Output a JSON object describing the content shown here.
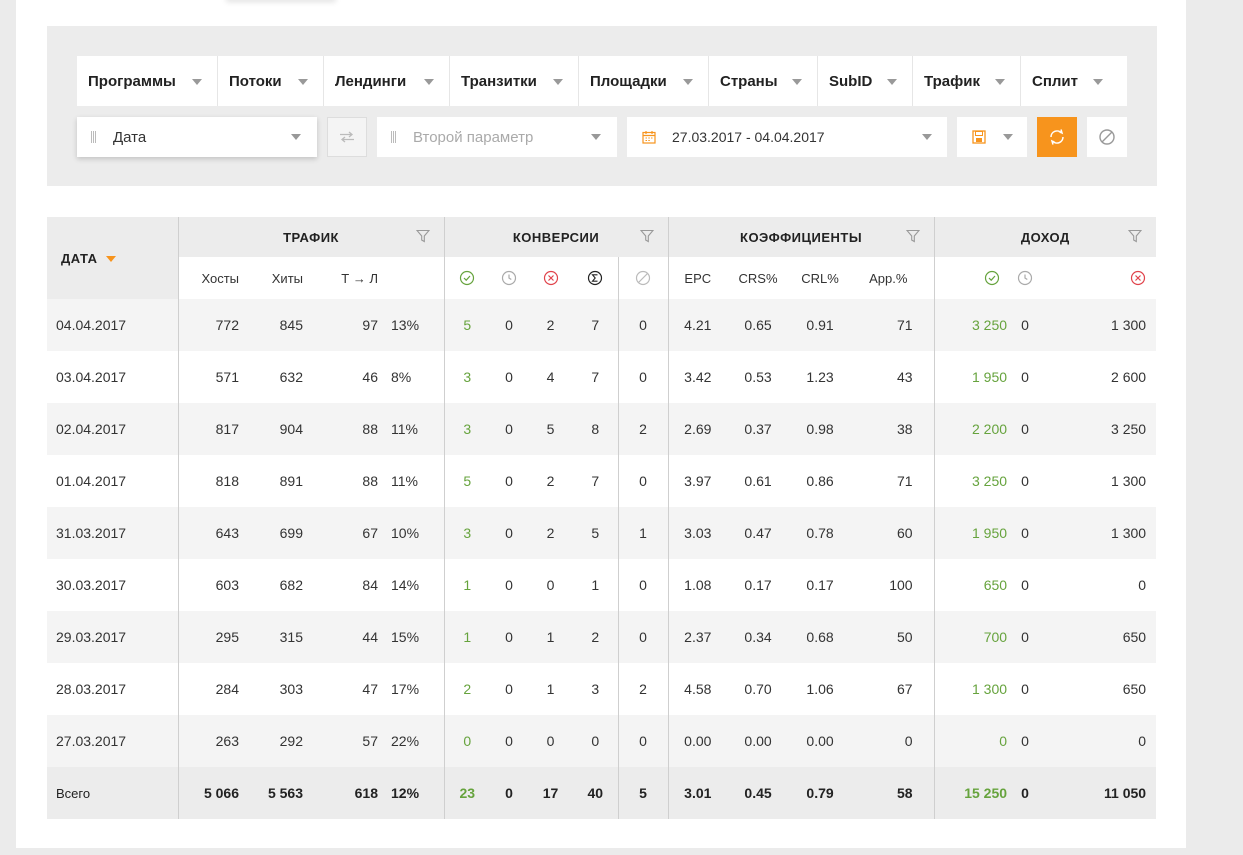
{
  "filters": {
    "tabs": [
      {
        "label": "Программы"
      },
      {
        "label": "Потоки"
      },
      {
        "label": "Лендинги"
      },
      {
        "label": "Транзитки"
      },
      {
        "label": "Площадки"
      },
      {
        "label": "Страны"
      },
      {
        "label": "SubID"
      },
      {
        "label": "Трафик"
      },
      {
        "label": "Сплит"
      }
    ],
    "first_param": "Дата",
    "second_param_placeholder": "Второй параметр",
    "date_range": "27.03.2017 - 04.04.2017"
  },
  "colors": {
    "accent": "#f7941d",
    "positive": "#66a33d",
    "negative": "#e0434b"
  },
  "table": {
    "date_header": "ДАТА",
    "groups": {
      "traffic": "ТРАФИК",
      "conversions": "КОНВЕРСИИ",
      "coefficients": "КОЭФФИЦИЕНТЫ",
      "income": "ДОХОД"
    },
    "sub": {
      "hosts": "Хосты",
      "hits": "Хиты",
      "tl": "Т → Л",
      "epc": "EPC",
      "crs": "CRS%",
      "crl": "CRL%",
      "app": "App.%"
    },
    "rows": [
      {
        "date": "04.04.2017",
        "hosts": "772",
        "hits": "845",
        "tl": "97",
        "tlp": "13%",
        "c_ok": "5",
        "c_wait": "0",
        "c_rej": "2",
        "c_sum": "7",
        "c_trash": "0",
        "epc": "4.21",
        "crs": "0.65",
        "crl": "0.91",
        "app": "71",
        "i_ok": "3 250",
        "i_wait": "0",
        "i_rej": "1 300"
      },
      {
        "date": "03.04.2017",
        "hosts": "571",
        "hits": "632",
        "tl": "46",
        "tlp": "8%",
        "c_ok": "3",
        "c_wait": "0",
        "c_rej": "4",
        "c_sum": "7",
        "c_trash": "0",
        "epc": "3.42",
        "crs": "0.53",
        "crl": "1.23",
        "app": "43",
        "i_ok": "1 950",
        "i_wait": "0",
        "i_rej": "2 600"
      },
      {
        "date": "02.04.2017",
        "hosts": "817",
        "hits": "904",
        "tl": "88",
        "tlp": "11%",
        "c_ok": "3",
        "c_wait": "0",
        "c_rej": "5",
        "c_sum": "8",
        "c_trash": "2",
        "epc": "2.69",
        "crs": "0.37",
        "crl": "0.98",
        "app": "38",
        "i_ok": "2 200",
        "i_wait": "0",
        "i_rej": "3 250"
      },
      {
        "date": "01.04.2017",
        "hosts": "818",
        "hits": "891",
        "tl": "88",
        "tlp": "11%",
        "c_ok": "5",
        "c_wait": "0",
        "c_rej": "2",
        "c_sum": "7",
        "c_trash": "0",
        "epc": "3.97",
        "crs": "0.61",
        "crl": "0.86",
        "app": "71",
        "i_ok": "3 250",
        "i_wait": "0",
        "i_rej": "1 300"
      },
      {
        "date": "31.03.2017",
        "hosts": "643",
        "hits": "699",
        "tl": "67",
        "tlp": "10%",
        "c_ok": "3",
        "c_wait": "0",
        "c_rej": "2",
        "c_sum": "5",
        "c_trash": "1",
        "epc": "3.03",
        "crs": "0.47",
        "crl": "0.78",
        "app": "60",
        "i_ok": "1 950",
        "i_wait": "0",
        "i_rej": "1 300"
      },
      {
        "date": "30.03.2017",
        "hosts": "603",
        "hits": "682",
        "tl": "84",
        "tlp": "14%",
        "c_ok": "1",
        "c_wait": "0",
        "c_rej": "0",
        "c_sum": "1",
        "c_trash": "0",
        "epc": "1.08",
        "crs": "0.17",
        "crl": "0.17",
        "app": "100",
        "i_ok": "650",
        "i_wait": "0",
        "i_rej": "0"
      },
      {
        "date": "29.03.2017",
        "hosts": "295",
        "hits": "315",
        "tl": "44",
        "tlp": "15%",
        "c_ok": "1",
        "c_wait": "0",
        "c_rej": "1",
        "c_sum": "2",
        "c_trash": "0",
        "epc": "2.37",
        "crs": "0.34",
        "crl": "0.68",
        "app": "50",
        "i_ok": "700",
        "i_wait": "0",
        "i_rej": "650"
      },
      {
        "date": "28.03.2017",
        "hosts": "284",
        "hits": "303",
        "tl": "47",
        "tlp": "17%",
        "c_ok": "2",
        "c_wait": "0",
        "c_rej": "1",
        "c_sum": "3",
        "c_trash": "2",
        "epc": "4.58",
        "crs": "0.70",
        "crl": "1.06",
        "app": "67",
        "i_ok": "1 300",
        "i_wait": "0",
        "i_rej": "650"
      },
      {
        "date": "27.03.2017",
        "hosts": "263",
        "hits": "292",
        "tl": "57",
        "tlp": "22%",
        "c_ok": "0",
        "c_wait": "0",
        "c_rej": "0",
        "c_sum": "0",
        "c_trash": "0",
        "epc": "0.00",
        "crs": "0.00",
        "crl": "0.00",
        "app": "0",
        "i_ok": "0",
        "i_wait": "0",
        "i_rej": "0"
      }
    ],
    "total": {
      "date": "Всего",
      "hosts": "5 066",
      "hits": "5 563",
      "tl": "618",
      "tlp": "12%",
      "c_ok": "23",
      "c_wait": "0",
      "c_rej": "17",
      "c_sum": "40",
      "c_trash": "5",
      "epc": "3.01",
      "crs": "0.45",
      "crl": "0.79",
      "app": "58",
      "i_ok": "15 250",
      "i_wait": "0",
      "i_rej": "11 050"
    }
  }
}
